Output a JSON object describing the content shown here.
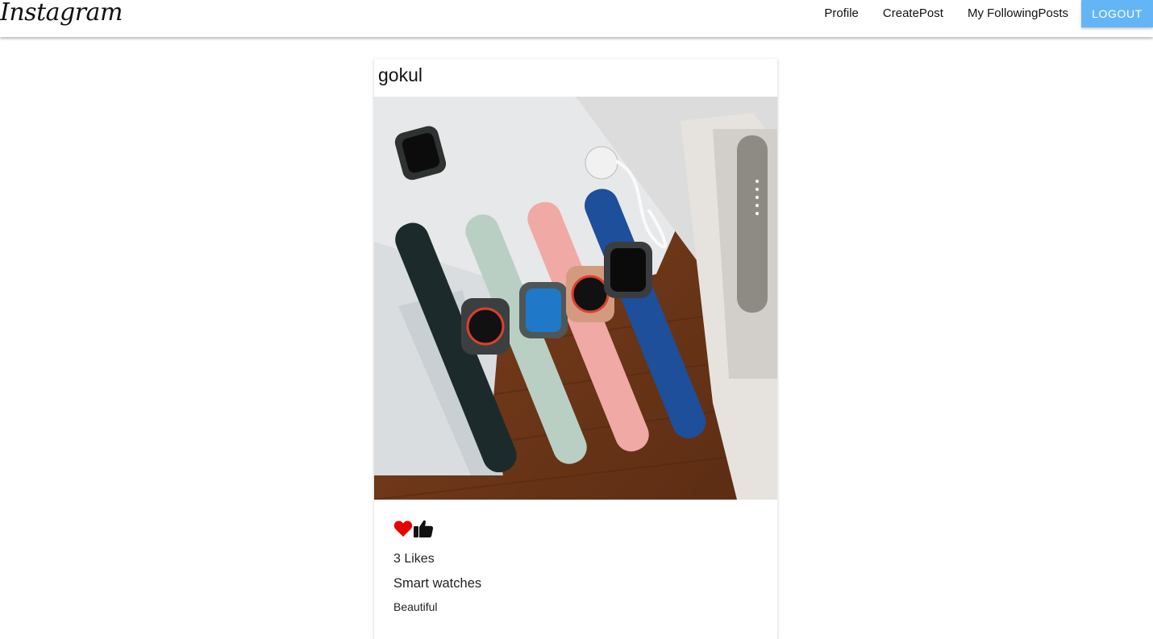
{
  "nav": {
    "brand": "Instagram",
    "links": [
      "Profile",
      "CreatePost",
      "My FollowingPosts"
    ],
    "logout_label": "LOGOUT"
  },
  "post": {
    "username": "gokul",
    "likes_text": "3 Likes",
    "title": "Smart watches",
    "body": "Beautiful",
    "liked": true
  },
  "colors": {
    "logout_button": "#64b5f6",
    "heart": "#e60000"
  },
  "icons": {
    "like": "heart-icon",
    "thumbs": "thumbs-up-icon"
  }
}
